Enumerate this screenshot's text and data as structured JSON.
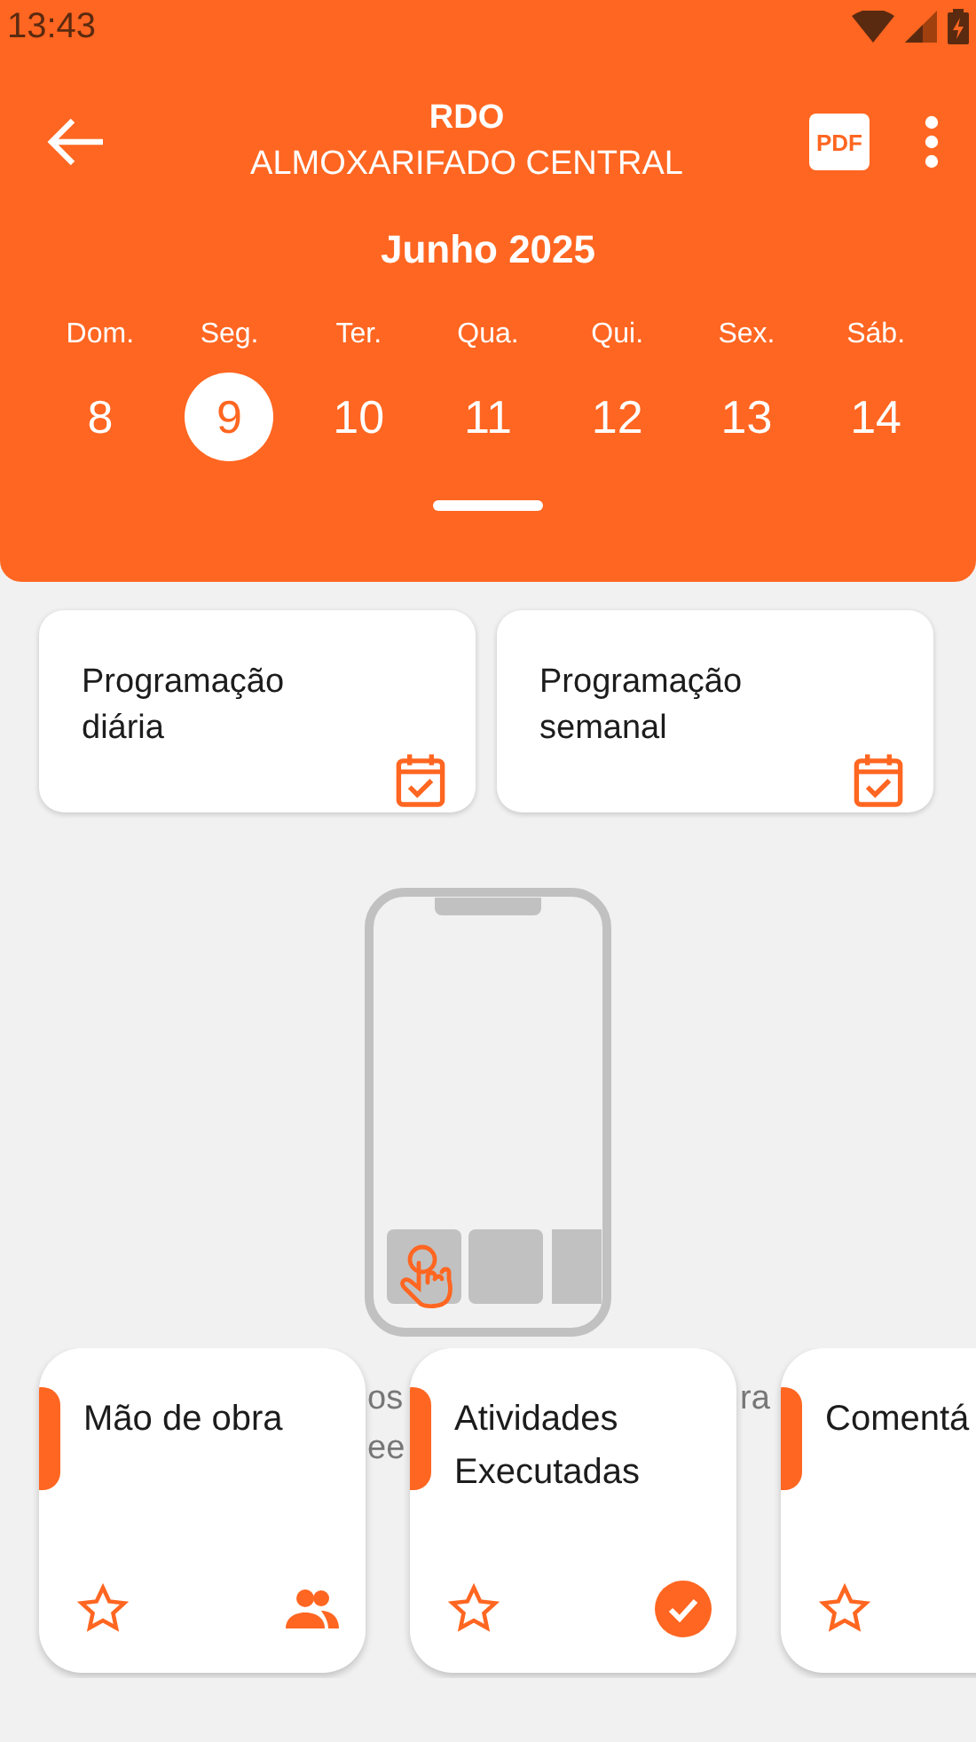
{
  "status_bar": {
    "time": "13:43"
  },
  "header": {
    "title": "RDO",
    "subtitle": "ALMOXARIFADO CENTRAL",
    "pdf_label": "PDF",
    "month": "Junho 2025",
    "days": [
      {
        "weekday": "Dom.",
        "day": "8",
        "selected": false
      },
      {
        "weekday": "Seg.",
        "day": "9",
        "selected": true
      },
      {
        "weekday": "Ter.",
        "day": "10",
        "selected": false
      },
      {
        "weekday": "Qua.",
        "day": "11",
        "selected": false
      },
      {
        "weekday": "Qui.",
        "day": "12",
        "selected": false
      },
      {
        "weekday": "Sex.",
        "day": "13",
        "selected": false
      },
      {
        "weekday": "Sáb.",
        "day": "14",
        "selected": false
      }
    ]
  },
  "schedule_cards": [
    {
      "label": "Programação diária"
    },
    {
      "label": "Programação semanal"
    }
  ],
  "hint_fragments": [
    "os",
    "ee",
    "ra"
  ],
  "section_cards": [
    {
      "label": "Mão de obra",
      "kind": "team"
    },
    {
      "label": "Atividades Executadas",
      "kind": "done"
    },
    {
      "label": "Comentá",
      "kind": "none"
    }
  ]
}
